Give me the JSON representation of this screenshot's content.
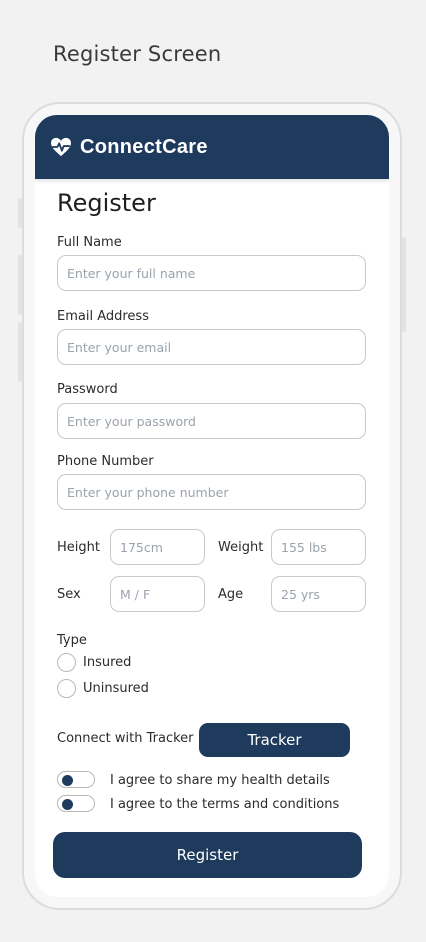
{
  "caption": "Register Screen",
  "app": {
    "icon": "heart-pulse-icon",
    "name": "ConnectCare",
    "brand_color": "#1e3a5c"
  },
  "form": {
    "heading": "Register",
    "full_name": {
      "label": "Full Name",
      "placeholder": "Enter your full name"
    },
    "email": {
      "label": "Email Address",
      "placeholder": "Enter your email"
    },
    "password": {
      "label": "Password",
      "placeholder": "Enter your password"
    },
    "phone": {
      "label": "Phone Number",
      "placeholder": "Enter your phone number"
    },
    "height": {
      "label": "Height",
      "placeholder": "175cm"
    },
    "weight": {
      "label": "Weight",
      "placeholder": "155 lbs"
    },
    "sex": {
      "label": "Sex",
      "placeholder": "M / F"
    },
    "age": {
      "label": "Age",
      "placeholder": "25 yrs"
    },
    "type": {
      "label": "Type",
      "options": [
        "Insured",
        "Uninsured"
      ]
    },
    "tracker": {
      "label": "Connect with Tracker",
      "button": "Tracker"
    },
    "consents": [
      {
        "text": "I agree to share my health details"
      },
      {
        "text": "I agree to the terms and conditions"
      }
    ],
    "submit": "Register"
  }
}
